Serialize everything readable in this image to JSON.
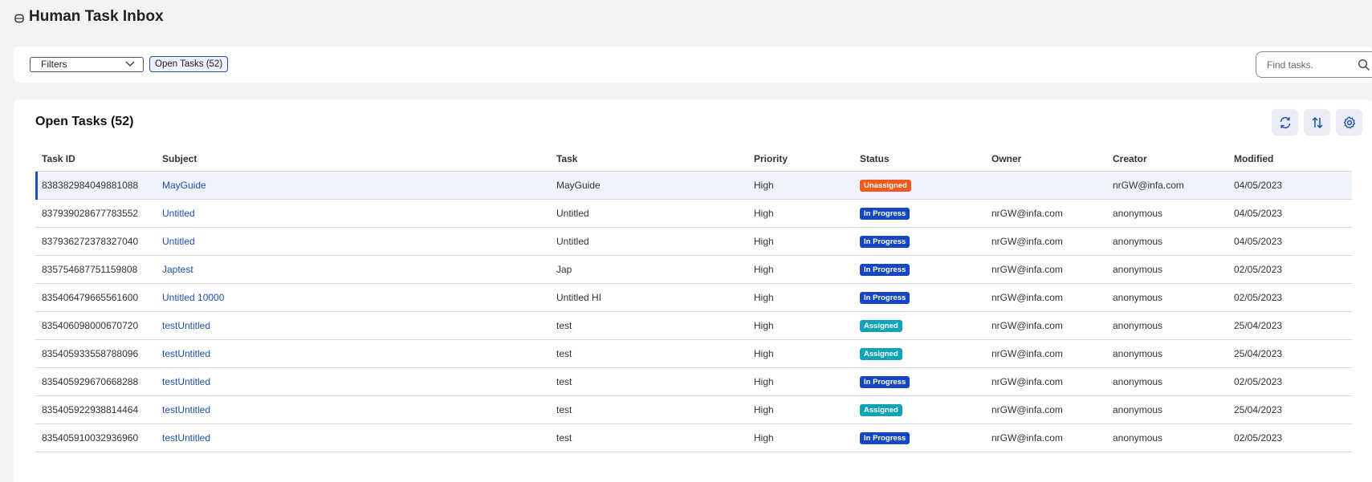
{
  "page": {
    "title": "Human Task Inbox",
    "header_icon": "inbox-icon"
  },
  "filter_bar": {
    "filters_label": "Filters",
    "chip_label": "Open Tasks (52)",
    "search_placeholder": "Find tasks.",
    "search_value": ""
  },
  "card": {
    "title": "Open Tasks (52)",
    "tools": [
      "refresh-icon",
      "sort-icon",
      "settings-icon"
    ]
  },
  "colors": {
    "accent": "#1f4fa8",
    "unassigned": "#f25a1d",
    "in_progress": "#1647c2",
    "assigned": "#0fa3b8"
  },
  "table": {
    "columns": [
      "Task ID",
      "Subject",
      "Task",
      "Priority",
      "Status",
      "Owner",
      "Creator",
      "Modified"
    ],
    "rows": [
      {
        "id": "838382984049881088",
        "subject": "MayGuide",
        "task": "MayGuide",
        "priority": "High",
        "status": "Unassigned",
        "owner": "",
        "creator": "nrGW@infa.com",
        "modified": "04/05/2023"
      },
      {
        "id": "837939028677783552",
        "subject": "Untitled",
        "task": "Untitled",
        "priority": "High",
        "status": "In Progress",
        "owner": "nrGW@infa.com",
        "creator": "anonymous",
        "modified": "04/05/2023"
      },
      {
        "id": "837936272378327040",
        "subject": "Untitled",
        "task": "Untitled",
        "priority": "High",
        "status": "In Progress",
        "owner": "nrGW@infa.com",
        "creator": "anonymous",
        "modified": "04/05/2023"
      },
      {
        "id": "835754687751159808",
        "subject": "Japtest",
        "task": "Jap",
        "priority": "High",
        "status": "In Progress",
        "owner": "nrGW@infa.com",
        "creator": "anonymous",
        "modified": "02/05/2023"
      },
      {
        "id": "835406479665561600",
        "subject": "Untitled 10000",
        "task": "Untitled HI",
        "priority": "High",
        "status": "In Progress",
        "owner": "nrGW@infa.com",
        "creator": "anonymous",
        "modified": "02/05/2023"
      },
      {
        "id": "835406098000670720",
        "subject": "testUntitled",
        "task": "test",
        "priority": "High",
        "status": "Assigned",
        "owner": "nrGW@infa.com",
        "creator": "anonymous",
        "modified": "25/04/2023"
      },
      {
        "id": "835405933558788096",
        "subject": "testUntitled",
        "task": "test",
        "priority": "High",
        "status": "Assigned",
        "owner": "nrGW@infa.com",
        "creator": "anonymous",
        "modified": "25/04/2023"
      },
      {
        "id": "835405929670668288",
        "subject": "testUntitled",
        "task": "test",
        "priority": "High",
        "status": "In Progress",
        "owner": "nrGW@infa.com",
        "creator": "anonymous",
        "modified": "02/05/2023"
      },
      {
        "id": "835405922938814464",
        "subject": "testUntitled",
        "task": "test",
        "priority": "High",
        "status": "Assigned",
        "owner": "nrGW@infa.com",
        "creator": "anonymous",
        "modified": "25/04/2023"
      },
      {
        "id": "835405910032936960",
        "subject": "testUntitled",
        "task": "test",
        "priority": "High",
        "status": "In Progress",
        "owner": "nrGW@infa.com",
        "creator": "anonymous",
        "modified": "02/05/2023"
      }
    ]
  }
}
